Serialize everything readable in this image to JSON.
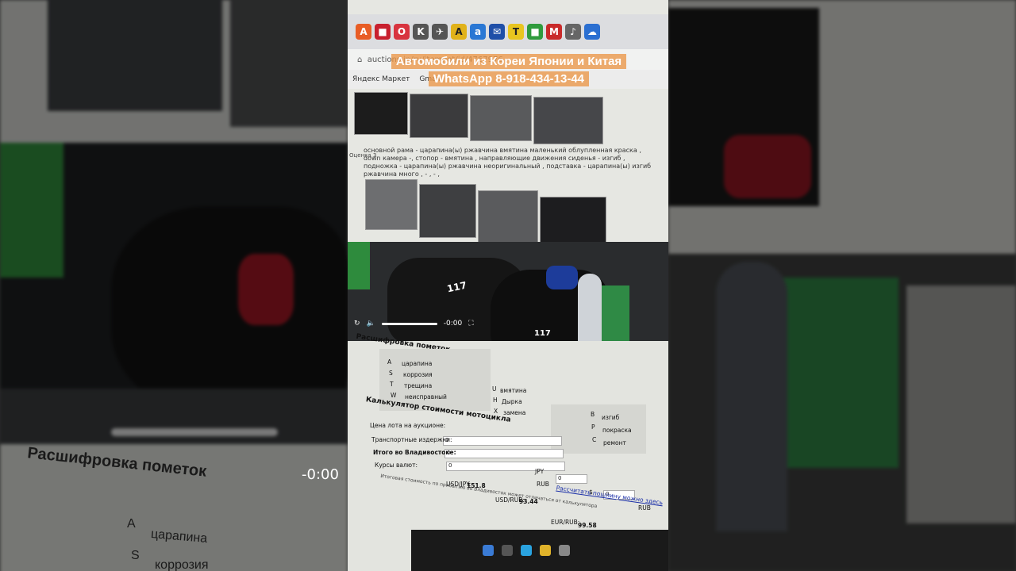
{
  "overlay": {
    "line1": "Автомобили из Кореи Японии и Китая",
    "line2": "WhatsApp 8-918-434-13-44"
  },
  "browser": {
    "url": "auctions.jp/ru/item/lot/id/4767976",
    "bookmarks": [
      "Яндекс Маркет",
      "Gmail"
    ]
  },
  "damage": {
    "label": "Оценка 3",
    "note": "основной рама - царапина(ы) ржавчина вмятина маленький облупленная краска , down камера -, стопор - вмятина , направляющие движения сиденья - изгиб , подножка - царапина(ы) ржавчина неоригинальный , подставка - царапина(ы) изгиб ржавчина много , - , - ,"
  },
  "video": {
    "time": "-0:00",
    "num1": "117",
    "num2": "117"
  },
  "legend": {
    "title": "Расшифровка пометок",
    "col1": [
      {
        "code": "A",
        "label": "царапина"
      },
      {
        "code": "S",
        "label": "коррозия"
      },
      {
        "code": "T",
        "label": "трещина"
      },
      {
        "code": "W",
        "label": "неисправный"
      }
    ],
    "col2": [
      {
        "code": "U",
        "label": "вмятина"
      },
      {
        "code": "H",
        "label": "Дырка"
      },
      {
        "code": "X",
        "label": "замена"
      }
    ],
    "col3": [
      {
        "code": "B",
        "label": "изгиб"
      },
      {
        "code": "P",
        "label": "покраска"
      },
      {
        "code": "C",
        "label": "ремонт"
      }
    ]
  },
  "calculator": {
    "title": "Калькулятор стоимости мотоцикла",
    "rows": [
      {
        "label": "Цена лота на аукционе:",
        "value": "0"
      },
      {
        "label": "Транспортные издержки:",
        "value": "0"
      },
      {
        "label": "Итого во Владивостоке:",
        "value": "0"
      },
      {
        "label": "Курсы валют:",
        "value": "0"
      }
    ],
    "jpy_label": "JPY",
    "usd_sign": "$",
    "rub_label": "RUB",
    "usdjpy_label": "USD/JPY:",
    "usdjpy_value": "151.8",
    "usdrub_label": "USD/RUB:",
    "usdrub_value": "93.44",
    "eurrub_label": "EUR/RUB:",
    "eurrub_value": "99.58",
    "link": "Рассчитать пошлину можно здесь",
    "footer": "Итоговая стоимость по прибытию во Владивосток может отличаться от калькулятора",
    "big_title": "Расшифровка пометок",
    "big_code": "A",
    "big_label": "царапина",
    "big_code2": "S",
    "big_label2": "коррозия",
    "big_time": "-0:00"
  },
  "colors": {
    "accent": "#eb9646",
    "link": "#1a2ea8",
    "green": "#2e8b3d"
  }
}
